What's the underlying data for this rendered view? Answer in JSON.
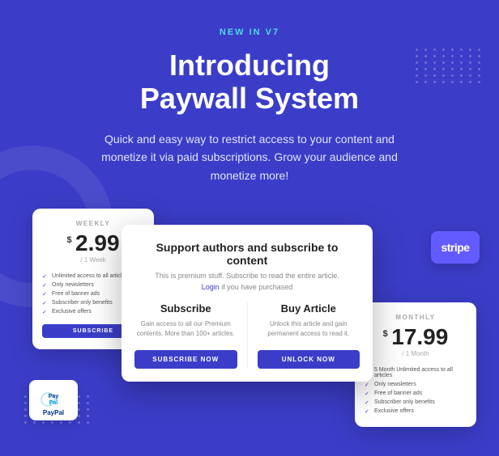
{
  "badge": "NEW IN V7",
  "title": "Introducing\nPaywall System",
  "subtitle": "Quick and easy way to restrict access to your content and monetize it via paid subscriptions. Grow your audience and monetize more!",
  "weekly_card": {
    "label": "WEEKLY",
    "currency": "$",
    "price": "2.99",
    "period": "/ 1 Week",
    "features": [
      "Unlimited access to all articles",
      "Only newsletters",
      "Free of banner ads",
      "Subscriber only benefits",
      "Exclusive offers"
    ],
    "button_label": "SUBSCRIBE"
  },
  "modal": {
    "title": "Support authors and subscribe to content",
    "description": "This is premium stuff. Subscribe to read the entire article.",
    "login_text": "Login",
    "login_suffix": " if you have purchased",
    "subscribe": {
      "title": "Subscribe",
      "description": "Gain access to all our Premium contents. More than 100+ articles.",
      "button_label": "SUBSCRIBE NOW"
    },
    "buy_article": {
      "title": "Buy Article",
      "description": "Unlock this article and gain permanent access to read it.",
      "button_label": "UNLOCK NOW"
    }
  },
  "monthly_card": {
    "label": "MONTHLY",
    "currency": "$",
    "price": "17.99",
    "period": "/ 1 Month",
    "features": [
      "5 Month Unlimited access to all articles",
      "Only newsletters",
      "Free of banner ads",
      "Subscriber only benefits",
      "Exclusive offers"
    ]
  },
  "paypal": {
    "text": "PayPal"
  },
  "stripe": {
    "text": "stripe"
  }
}
